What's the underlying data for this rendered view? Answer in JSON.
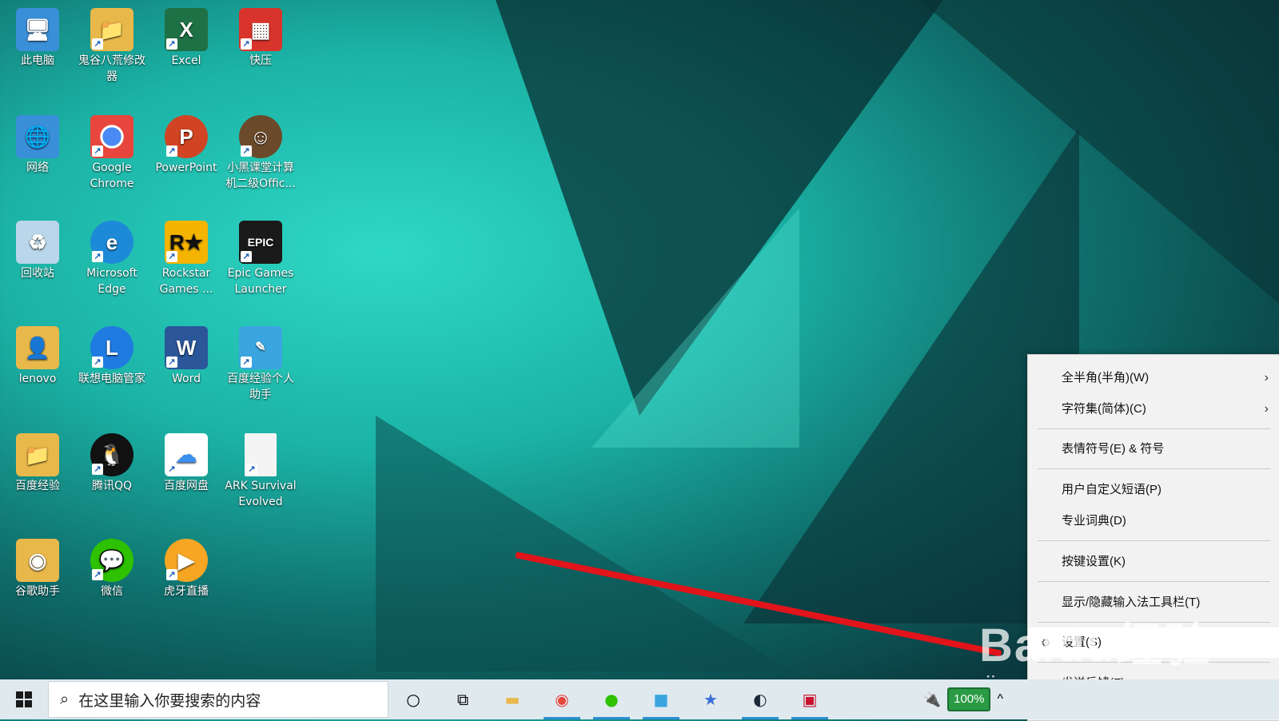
{
  "desktop_icons": [
    {
      "label": "此电脑",
      "icon": "this-pc-icon",
      "color": "#3a8fd9"
    },
    {
      "label": "鬼谷八荒修改器",
      "icon": "folder-icon",
      "color": "#e8b84a"
    },
    {
      "label": "Excel",
      "icon": "excel-icon",
      "color": "#1e7145"
    },
    {
      "label": "快压",
      "icon": "kuaiya-icon",
      "color": "#d9342b"
    },
    {
      "label": "网络",
      "icon": "network-icon",
      "color": "#3a8fd9"
    },
    {
      "label": "Google Chrome",
      "icon": "chrome-icon",
      "color": "#e8453c"
    },
    {
      "label": "PowerPoint",
      "icon": "powerpoint-icon",
      "color": "#d04423"
    },
    {
      "label": "小黑课堂计算机二级Offic...",
      "icon": "xiaohei-icon",
      "color": "#6b4a2b"
    },
    {
      "label": "回收站",
      "icon": "recycle-bin-icon",
      "color": "#b9d6ea"
    },
    {
      "label": "Microsoft Edge",
      "icon": "edge-icon",
      "color": "#1d8ad8"
    },
    {
      "label": "Rockstar Games ...",
      "icon": "rockstar-icon",
      "color": "#f4b400"
    },
    {
      "label": "Epic Games Launcher",
      "icon": "epic-games-icon",
      "color": "#1a1a1a"
    },
    {
      "label": "lenovo",
      "icon": "user-folder-icon",
      "color": "#e8b84a"
    },
    {
      "label": "联想电脑管家",
      "icon": "lenovo-manager-icon",
      "color": "#1f7be0"
    },
    {
      "label": "Word",
      "icon": "word-icon",
      "color": "#2b579a"
    },
    {
      "label": "百度经验个人助手",
      "icon": "baidu-jingyan-icon",
      "color": "#3aa5e0"
    },
    {
      "label": "百度经验",
      "icon": "folder-icon",
      "color": "#e8b84a"
    },
    {
      "label": "腾讯QQ",
      "icon": "qq-icon",
      "color": "#111111"
    },
    {
      "label": "百度网盘",
      "icon": "baidu-netdisk-icon",
      "color": "#3b8ff0"
    },
    {
      "label": "ARK Survival Evolved",
      "icon": "file-icon",
      "color": "#f4f4f4"
    },
    {
      "label": "谷歌助手",
      "icon": "google-helper-icon",
      "color": "#e8b84a"
    },
    {
      "label": "微信",
      "icon": "wechat-icon",
      "color": "#2dc100"
    },
    {
      "label": "虎牙直播",
      "icon": "huya-icon",
      "color": "#f6a623"
    }
  ],
  "context_menu": {
    "items": [
      {
        "label": "全半角(半角)(W)",
        "submenu": true
      },
      {
        "label": "字符集(简体)(C)",
        "submenu": true
      },
      {
        "label": "表情符号(E) & 符号",
        "submenu": false
      },
      {
        "label": "用户自定义短语(P)",
        "submenu": false
      },
      {
        "label": "专业词典(D)",
        "submenu": false
      },
      {
        "label": "按键设置(K)",
        "submenu": false
      },
      {
        "label": "显示/隐藏输入法工具栏(T)",
        "submenu": false
      },
      {
        "label": "设置(S)",
        "submenu": false,
        "highlighted": true
      },
      {
        "label": "发送反馈(F)",
        "submenu": false
      }
    ],
    "submenu_glyph": "›",
    "gear_glyph": "⚙"
  },
  "taskbar": {
    "search_placeholder": "在这里输入你要搜索的内容",
    "battery": "100%",
    "apps": [
      "cortana-icon",
      "task-view-icon",
      "file-explorer-icon",
      "chrome-icon",
      "wechat-icon",
      "baidu-jingyan-icon",
      "star-app-icon",
      "steam-icon",
      "nba2k21-icon"
    ]
  },
  "watermark": {
    "main": "Baidu经验",
    "sub": "jingyan.baidu.com"
  },
  "colors": {
    "accent": "#2d8fd5",
    "arrow": "#e0141a",
    "menu_bg": "#f2f2f2"
  }
}
